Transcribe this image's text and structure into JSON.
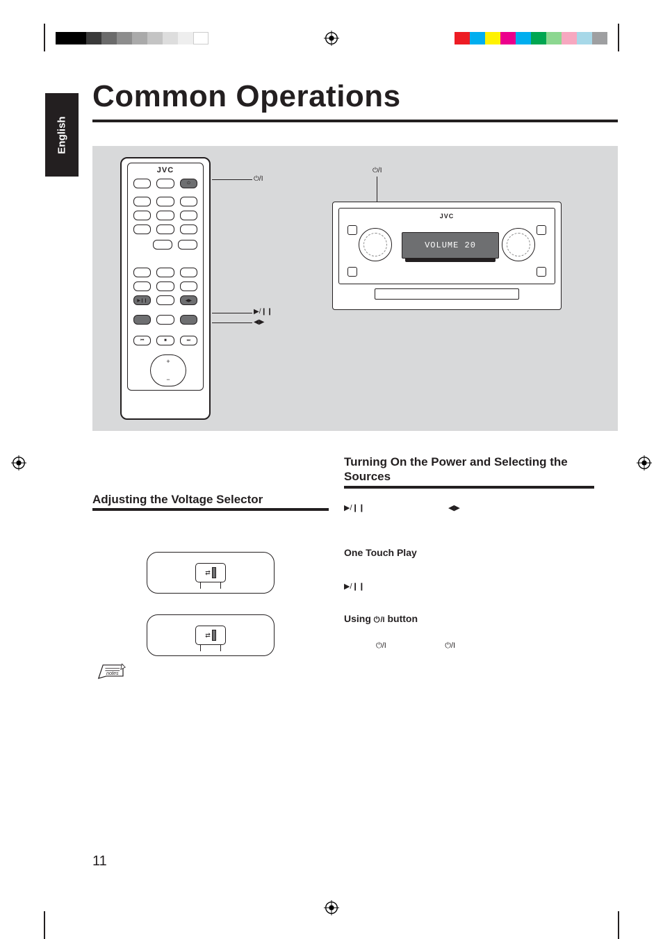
{
  "language_tab": "English",
  "page_title": "Common Operations",
  "page_number": "11",
  "remote": {
    "brand": "JVC",
    "callouts": {
      "power": "⏻/I",
      "play_pause": "▶/❙❙",
      "tape_direction": "◀▶"
    }
  },
  "unit": {
    "brand": "JVC",
    "power_callout": "⏻/I",
    "display_text": "VOLUME 20"
  },
  "left_column": {
    "heading": "Adjusting the Voltage Selector",
    "notes_label": "notes"
  },
  "right_column": {
    "heading": "Turning On the Power and Selecting the Sources",
    "symbol_play": "▶/❙❙",
    "symbol_tape": "◀▶",
    "one_touch_heading": "One Touch Play",
    "one_touch_symbol": "▶/❙❙",
    "using_button_pre": "Using ",
    "using_button_post": " button",
    "using_symbol1": "⏻/I",
    "using_symbol2": "⏻/I"
  },
  "print_colors_left": [
    "#000000",
    "#000000",
    "#333333",
    "#666666",
    "#999999",
    "#b3b3b3",
    "#cccccc",
    "#e6e6e6",
    "#ffffff",
    "#ffffff"
  ],
  "print_colors_right": [
    "#9e9fa1",
    "#a7d8e8",
    "#f7a8c0",
    "#8cd790",
    "#00a651",
    "#00aeef",
    "#ec008c",
    "#fff200",
    "#00aeef",
    "#ed1c24"
  ]
}
